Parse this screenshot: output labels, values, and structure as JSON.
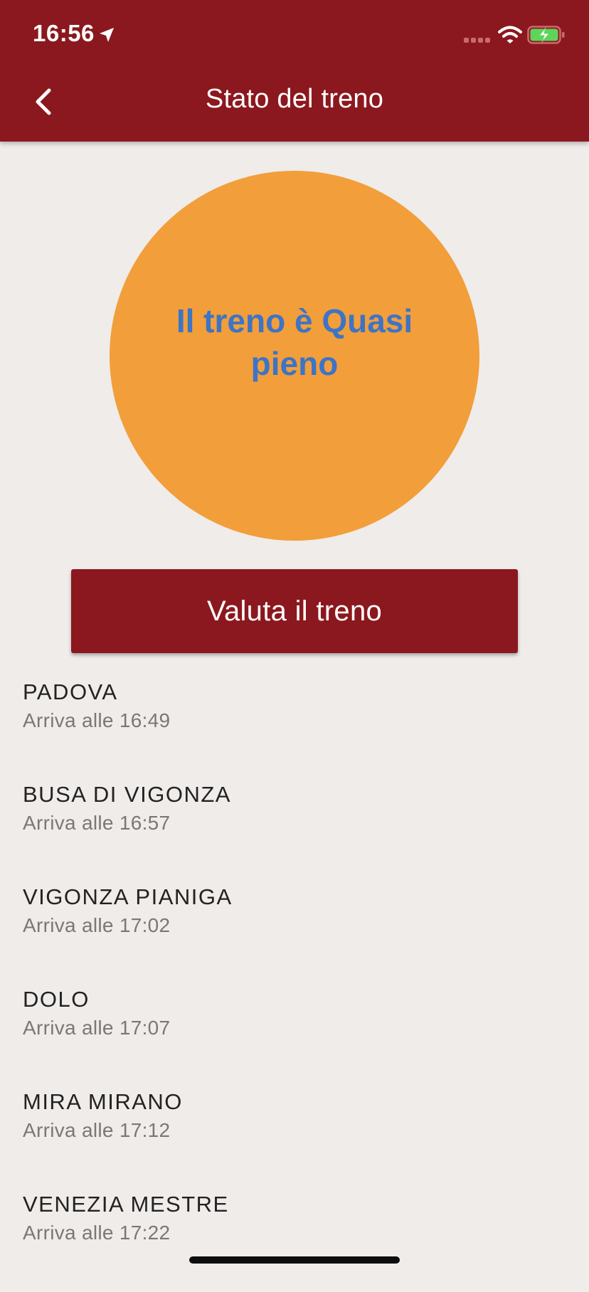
{
  "status_bar": {
    "time": "16:56",
    "icons": [
      "location-arrow-icon",
      "signal-icon",
      "wifi-icon",
      "battery-charging-icon"
    ]
  },
  "nav": {
    "back_icon": "chevron-left-icon",
    "title": "Stato del treno"
  },
  "status": {
    "text": "Il treno è Quasi pieno",
    "circle_color": "#f29e3a",
    "text_color": "#3d74c6"
  },
  "rate_button": {
    "label": "Valuta il treno"
  },
  "stops": [
    {
      "name": "PADOVA",
      "arrival": "Arriva alle 16:49"
    },
    {
      "name": "BUSA DI VIGONZA",
      "arrival": "Arriva alle 16:57"
    },
    {
      "name": "VIGONZA PIANIGA",
      "arrival": "Arriva alle 17:02"
    },
    {
      "name": "DOLO",
      "arrival": "Arriva alle 17:07"
    },
    {
      "name": "MIRA MIRANO",
      "arrival": "Arriva alle 17:12"
    },
    {
      "name": "VENEZIA MESTRE",
      "arrival": "Arriva alle 17:22"
    }
  ],
  "colors": {
    "brand": "#8b181e",
    "background": "#efecea",
    "battery_green": "#5fd35a"
  }
}
